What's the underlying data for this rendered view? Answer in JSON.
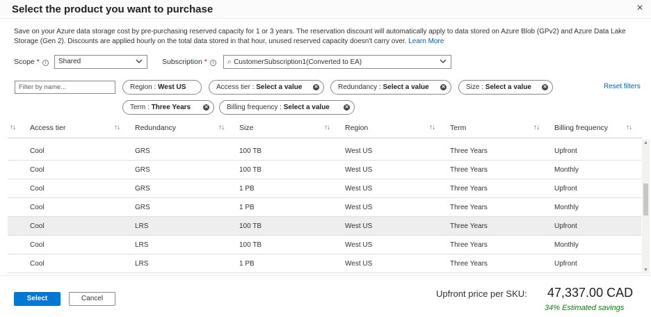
{
  "dialog": {
    "title": "Select the product you want to purchase",
    "close_glyph": "×",
    "description": "Save on your Azure data storage cost by pre-purchasing reserved capacity for 1 or 3 years. The reservation discount will automatically apply to data stored on Azure Blob (GPv2) and Azure Data Lake Storage (Gen 2). Discounts are applied hourly on the total data stored in that hour, unused reserved capacity doesn't carry over.",
    "learn_more": "Learn More"
  },
  "scope": {
    "label": "Scope",
    "required_mark": "*",
    "info_glyph": "i",
    "value": "Shared"
  },
  "subscription": {
    "label": "Subscription",
    "required_mark": "*",
    "info_glyph": "i",
    "search_glyph": "⌕",
    "value": "CustomerSubscription1(Converted to EA)"
  },
  "filters": {
    "placeholder": "Filter by name...",
    "reset_label": "Reset filters",
    "clear_glyph": "✕",
    "pills": [
      {
        "name": "Region",
        "value": "West US"
      },
      {
        "name": "Access tier",
        "value": "Select a value"
      },
      {
        "name": "Redundancy",
        "value": "Select a value"
      },
      {
        "name": "Size",
        "value": "Select a value"
      },
      {
        "name": "Term",
        "value": "Three Years"
      },
      {
        "name": "Billing frequency",
        "value": "Select a value"
      }
    ]
  },
  "table": {
    "sort_glyph": "↑↓",
    "columns": [
      "Access tier",
      "Redundancy",
      "Size",
      "Region",
      "Term",
      "Billing frequency"
    ],
    "rows": [
      [
        "Cool",
        "GRS",
        "100 TB",
        "West US",
        "Three Years",
        "Upfront"
      ],
      [
        "Cool",
        "GRS",
        "100 TB",
        "West US",
        "Three Years",
        "Monthly"
      ],
      [
        "Cool",
        "GRS",
        "1 PB",
        "West US",
        "Three Years",
        "Upfront"
      ],
      [
        "Cool",
        "GRS",
        "1 PB",
        "West US",
        "Three Years",
        "Monthly"
      ],
      [
        "Cool",
        "LRS",
        "100 TB",
        "West US",
        "Three Years",
        "Upfront"
      ],
      [
        "Cool",
        "LRS",
        "100 TB",
        "West US",
        "Three Years",
        "Monthly"
      ],
      [
        "Cool",
        "LRS",
        "1 PB",
        "West US",
        "Three Years",
        "Upfront"
      ]
    ],
    "selected_row": 4
  },
  "footer": {
    "select_label": "Select",
    "cancel_label": "Cancel",
    "price_label": "Upfront price per SKU:",
    "price_value": "47,337.00 CAD",
    "savings": "34% Estimated savings"
  },
  "colors": {
    "accent": "#0078d4",
    "link": "#0063b1",
    "savings": "#107c10",
    "selected_row": "#eeeeee"
  }
}
